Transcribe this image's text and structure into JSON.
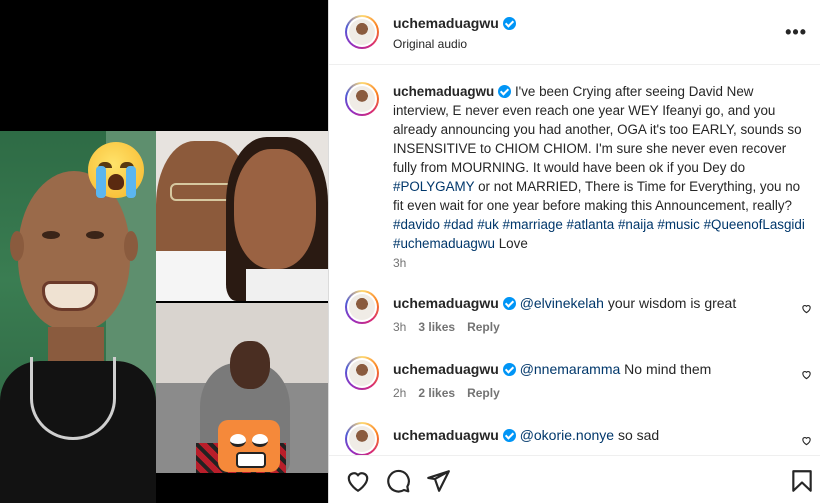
{
  "header": {
    "username": "uchemaduagwu",
    "subtitle": "Original audio",
    "more": "•••"
  },
  "caption": {
    "username": "uchemaduagwu",
    "text_1": "I've been Crying after seeing David New interview, E never even reach one year WEY Ifeanyi go, and you already announcing you had another, OGA it's too EARLY, sounds so INSENSITIVE to CHIOM CHIOM. I'm sure she never even recover fully from MOURNING. It would have been ok if you Dey do ",
    "tag_polygamy": "#POLYGAMY",
    "text_2": " or not MARRIED, There is Time for Everything, you no fit even wait for one year before making this Announcement, really? ",
    "tags": [
      "#davido",
      "#dad",
      "#uk",
      "#marriage",
      "#atlanta",
      "#naija",
      "#music",
      "#QueenofLasgidi",
      "#uchemaduagwu"
    ],
    "text_3": "Love",
    "time": "3h"
  },
  "comments": [
    {
      "username": "uchemaduagwu",
      "mention": "@elvinekelah",
      "text": "your wisdom is great",
      "time": "3h",
      "likes": "3 likes",
      "reply": "Reply"
    },
    {
      "username": "uchemaduagwu",
      "mention": "@nnemaramma",
      "text": "No mind them",
      "time": "2h",
      "likes": "2 likes",
      "reply": "Reply"
    },
    {
      "username": "uchemaduagwu",
      "mention": "@okorie.nonye",
      "text": "so sad",
      "time": "",
      "likes": "",
      "reply": ""
    }
  ],
  "actions": [
    "heart-icon",
    "comment-icon",
    "share-icon",
    "save-icon"
  ],
  "colors": {
    "link": "#00376b",
    "verified": "#0095f6",
    "muted": "#737373"
  }
}
